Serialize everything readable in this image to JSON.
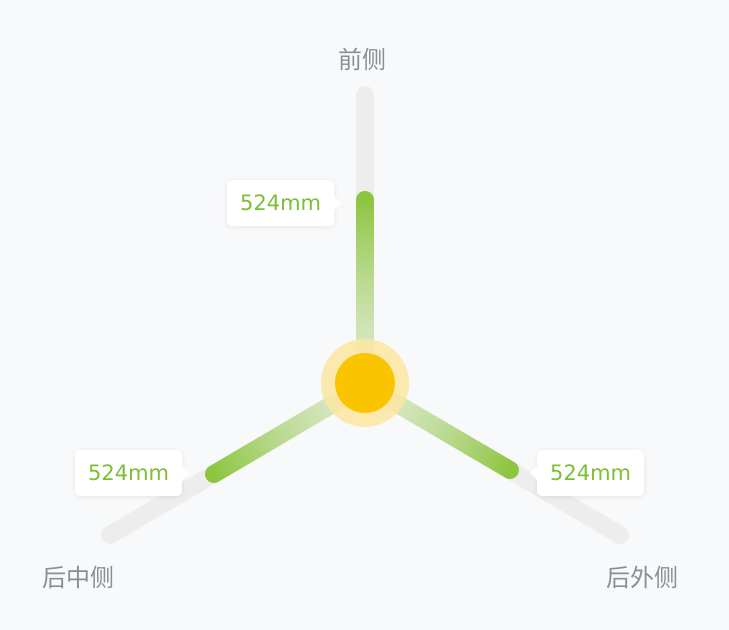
{
  "axes": {
    "front": {
      "label": "前侧",
      "value": "524mm"
    },
    "rear_middle": {
      "label": "后中侧",
      "value": "524mm"
    },
    "rear_outer": {
      "label": "后外侧",
      "value": "524mm"
    }
  },
  "colors": {
    "track": "#ededed",
    "bar": "#8dc540",
    "bar_fade": "#dcebc9",
    "center": "#fbc400",
    "center_halo": "#fbe7a4",
    "label_text": "#8a8f94",
    "value_text": "#7cbf34",
    "background": "#f8f9fa"
  }
}
